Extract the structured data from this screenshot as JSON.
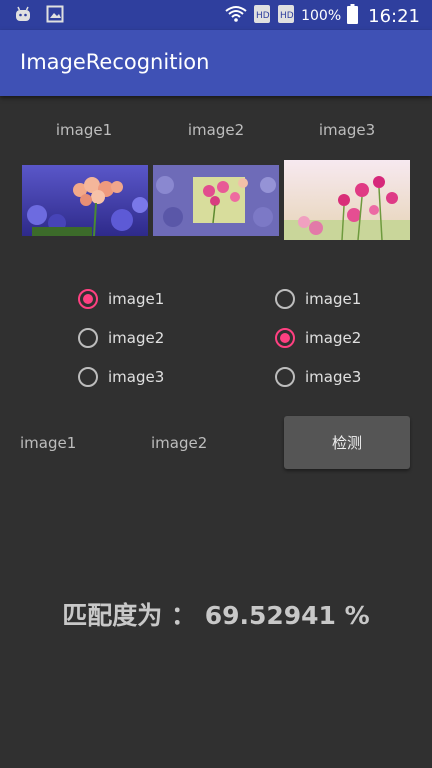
{
  "status_bar": {
    "battery_percent": "100%",
    "time": "16:21",
    "icons": [
      "android-icon",
      "image-icon",
      "wifi-icon",
      "sim1-icon",
      "sim2-icon",
      "battery-icon"
    ]
  },
  "app_bar": {
    "title": "ImageRecognition"
  },
  "images": {
    "labels": [
      "image1",
      "image2",
      "image3"
    ]
  },
  "radio_groups": {
    "left": {
      "options": [
        "image1",
        "image2",
        "image3"
      ],
      "selected": "image1"
    },
    "right": {
      "options": [
        "image1",
        "image2",
        "image3"
      ],
      "selected": "image2"
    }
  },
  "selection": {
    "first": "image1",
    "second": "image2"
  },
  "detect_button": {
    "label": "检测"
  },
  "result": {
    "text": "匹配度为 ： 69.52941 %"
  },
  "colors": {
    "status_bar": "#2f3f9e",
    "app_bar": "#3f51b5",
    "accent": "#ff4081",
    "background": "#303030"
  }
}
